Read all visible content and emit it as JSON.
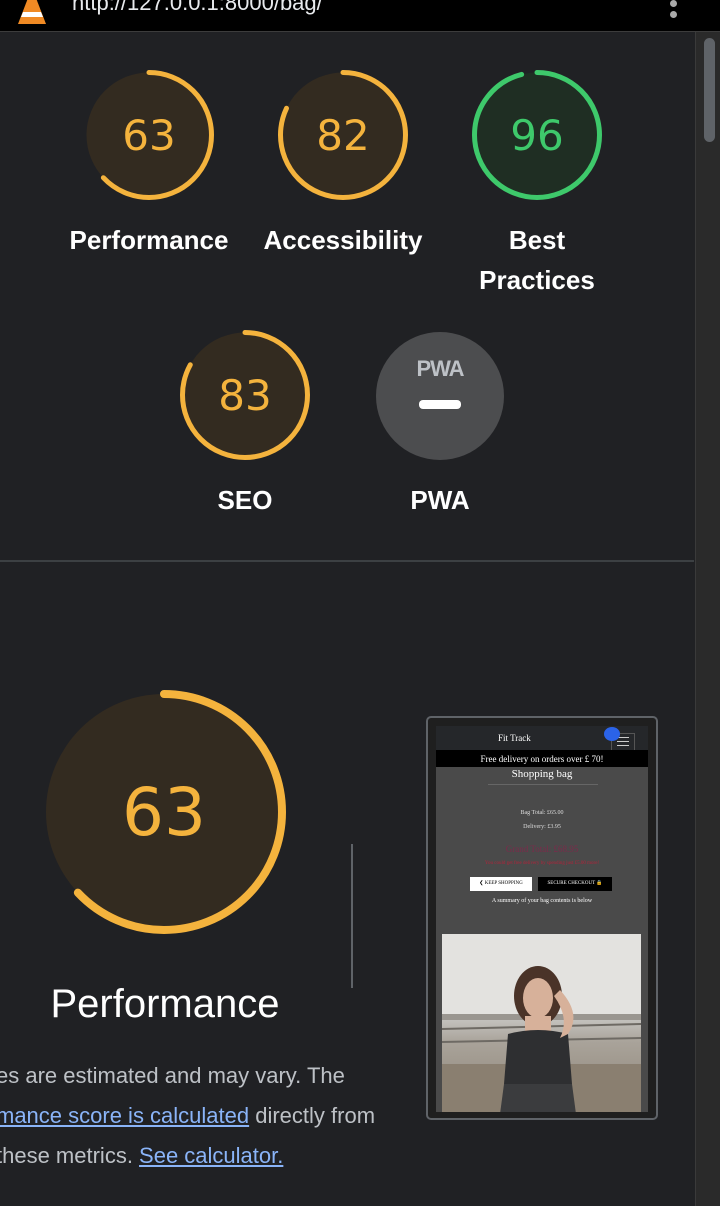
{
  "browser": {
    "url": "http://127.0.0.1:8000/bag/"
  },
  "summary_scores": [
    {
      "label": "Performance",
      "score": 63,
      "color": "#f4b33d"
    },
    {
      "label": "Accessibility",
      "score": 82,
      "color": "#f4b33d"
    },
    {
      "label": "Best Practices",
      "label_line1": "Best",
      "label_line2": "Practices",
      "score": 96,
      "color": "#3ec96b"
    },
    {
      "label": "SEO",
      "score": 83,
      "color": "#f4b33d"
    }
  ],
  "pwa": {
    "badge": "PWA",
    "label": "PWA"
  },
  "performance_section": {
    "score": 63,
    "color": "#f4b33d",
    "title": "Performance",
    "desc_line1": "es are estimated and may vary. The",
    "desc_link1": "mance score is calculated",
    "desc_line2_tail": " directly from",
    "desc_line3_head": " these metrics. ",
    "desc_link2": "See calculator."
  },
  "screenshot_preview": {
    "brand": "Fit Track",
    "banner": "Free delivery on orders over £ 70!",
    "title": "Shopping bag",
    "bag_total": "Bag Total: £65.00",
    "delivery": "Delivery: £3.95",
    "grand_total": "Grand Total: £68.95",
    "free_delivery_note": "You could get free delivery by spending just £5.00 more!",
    "keep_shopping": "❮ KEEP SHOPPING",
    "secure_checkout": "SECURE CHECKOUT 🔒",
    "summary": "A summary of your bag contents is below"
  },
  "colors": {
    "background": "#202124",
    "average": "#f4b33d",
    "pass": "#3ec96b",
    "link": "#8ab4f8"
  }
}
